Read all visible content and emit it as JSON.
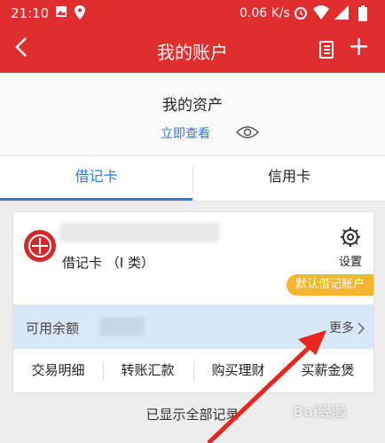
{
  "status_bar": {
    "time": "21:10",
    "network_speed": "0.06 K/s",
    "icons": [
      "image-icon",
      "location-icon",
      "alarm-icon",
      "wifi-icon",
      "signal-icon",
      "battery-icon"
    ]
  },
  "header": {
    "back_glyph": "〈",
    "title": "我的账户",
    "plus_glyph": "+"
  },
  "assets": {
    "label": "我的资产",
    "view_link": "立即查看"
  },
  "tabs": [
    {
      "label": "借记卡",
      "active": true
    },
    {
      "label": "信用卡",
      "active": false
    }
  ],
  "card": {
    "type_label": "借记卡 （I 类）",
    "settings_label": "设置",
    "default_badge": "默认借记账户",
    "balance_label": "可用余额",
    "more_label": "更多",
    "actions": [
      "交易明细",
      "转账汇款",
      "购买理财",
      "买薪金煲"
    ]
  },
  "footer": {
    "text": "已显示全部记录"
  },
  "watermark": "Bai经验",
  "colors": {
    "brand_red": "#e02d2d",
    "accent_blue": "#2f7cd8",
    "badge_yellow": "#f5b52d",
    "balance_bg": "#d9e8f6"
  }
}
